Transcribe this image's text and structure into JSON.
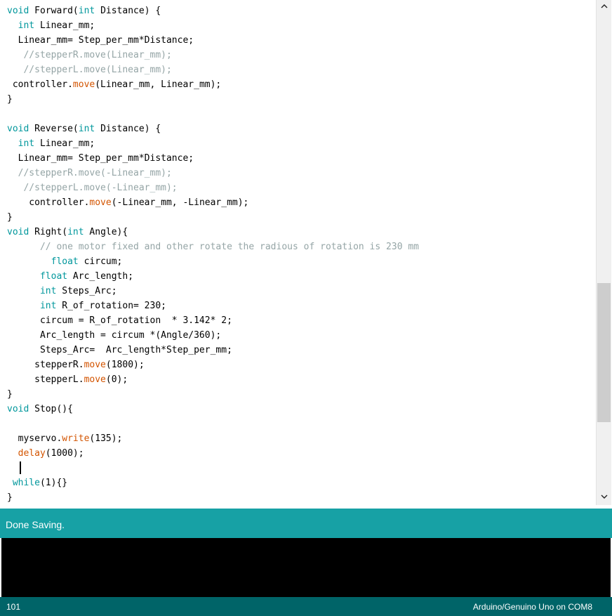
{
  "editor": {
    "lines": [
      [
        {
          "t": "void",
          "k": "kw"
        },
        {
          "t": " Forward(",
          "k": "plain"
        },
        {
          "t": "int",
          "k": "kw"
        },
        {
          "t": " Distance) {",
          "k": "plain"
        }
      ],
      [
        {
          "t": "  ",
          "k": "plain"
        },
        {
          "t": "int",
          "k": "kw"
        },
        {
          "t": " Linear_mm;",
          "k": "plain"
        }
      ],
      [
        {
          "t": "  Linear_mm= Step_per_mm*Distance;",
          "k": "plain"
        }
      ],
      [
        {
          "t": "   //stepperR.move(Linear_mm);",
          "k": "cm"
        }
      ],
      [
        {
          "t": "   //stepperL.move(Linear_mm);",
          "k": "cm"
        }
      ],
      [
        {
          "t": " controller.",
          "k": "plain"
        },
        {
          "t": "move",
          "k": "fn"
        },
        {
          "t": "(Linear_mm, Linear_mm);",
          "k": "plain"
        }
      ],
      [
        {
          "t": "}",
          "k": "plain"
        }
      ],
      [],
      [
        {
          "t": "void",
          "k": "kw"
        },
        {
          "t": " Reverse(",
          "k": "plain"
        },
        {
          "t": "int",
          "k": "kw"
        },
        {
          "t": " Distance) {",
          "k": "plain"
        }
      ],
      [
        {
          "t": "  ",
          "k": "plain"
        },
        {
          "t": "int",
          "k": "kw"
        },
        {
          "t": " Linear_mm;",
          "k": "plain"
        }
      ],
      [
        {
          "t": "  Linear_mm= Step_per_mm*Distance;",
          "k": "plain"
        }
      ],
      [
        {
          "t": "  //stepperR.move(-Linear_mm);",
          "k": "cm"
        }
      ],
      [
        {
          "t": "   //stepperL.move(-Linear_mm);",
          "k": "cm"
        }
      ],
      [
        {
          "t": "    controller.",
          "k": "plain"
        },
        {
          "t": "move",
          "k": "fn"
        },
        {
          "t": "(-Linear_mm, -Linear_mm);",
          "k": "plain"
        }
      ],
      [
        {
          "t": "}",
          "k": "plain"
        }
      ],
      [
        {
          "t": "void",
          "k": "kw"
        },
        {
          "t": " Right(",
          "k": "plain"
        },
        {
          "t": "int",
          "k": "kw"
        },
        {
          "t": " Angle){",
          "k": "plain"
        }
      ],
      [
        {
          "t": "      // one motor fixed and other rotate the radious of rotation is 230 mm",
          "k": "cm"
        }
      ],
      [
        {
          "t": "        ",
          "k": "plain"
        },
        {
          "t": "float",
          "k": "kw"
        },
        {
          "t": " circum;",
          "k": "plain"
        }
      ],
      [
        {
          "t": "      ",
          "k": "plain"
        },
        {
          "t": "float",
          "k": "kw"
        },
        {
          "t": " Arc_length;",
          "k": "plain"
        }
      ],
      [
        {
          "t": "      ",
          "k": "plain"
        },
        {
          "t": "int",
          "k": "kw"
        },
        {
          "t": " Steps_Arc;",
          "k": "plain"
        }
      ],
      [
        {
          "t": "      ",
          "k": "plain"
        },
        {
          "t": "int",
          "k": "kw"
        },
        {
          "t": " R_of_rotation= 230;",
          "k": "plain"
        }
      ],
      [
        {
          "t": "      circum = R_of_rotation  * 3.142* 2;",
          "k": "plain"
        }
      ],
      [
        {
          "t": "      Arc_length = circum *(Angle/360);",
          "k": "plain"
        }
      ],
      [
        {
          "t": "      Steps_Arc=  Arc_length*Step_per_mm;",
          "k": "plain"
        }
      ],
      [
        {
          "t": "     stepperR.",
          "k": "plain"
        },
        {
          "t": "move",
          "k": "fn"
        },
        {
          "t": "(1800);",
          "k": "plain"
        }
      ],
      [
        {
          "t": "     stepperL.",
          "k": "plain"
        },
        {
          "t": "move",
          "k": "fn"
        },
        {
          "t": "(0);",
          "k": "plain"
        }
      ],
      [
        {
          "t": "}",
          "k": "plain"
        }
      ],
      [
        {
          "t": "void",
          "k": "kw"
        },
        {
          "t": " Stop(){",
          "k": "plain"
        }
      ],
      [],
      [
        {
          "t": "  myservo.",
          "k": "plain"
        },
        {
          "t": "write",
          "k": "fn"
        },
        {
          "t": "(135);",
          "k": "plain"
        }
      ],
      [
        {
          "t": "  ",
          "k": "plain"
        },
        {
          "t": "delay",
          "k": "fn"
        },
        {
          "t": "(1000);",
          "k": "plain"
        }
      ],
      [],
      [
        {
          "t": " ",
          "k": "plain"
        },
        {
          "t": "while",
          "k": "kw"
        },
        {
          "t": "(1){}",
          "k": "plain"
        }
      ],
      [
        {
          "t": "}",
          "k": "plain"
        }
      ]
    ],
    "cursor_line": 32
  },
  "status": {
    "message": "Done Saving."
  },
  "footer": {
    "line_number": "101",
    "board_info": "Arduino/Genuino Uno on COM8"
  },
  "colors": {
    "keyword": "#00979c",
    "function": "#d35400",
    "comment": "#95a5a6",
    "status_bar": "#17a1a5",
    "footer_bar": "#006468",
    "console": "#000000"
  },
  "icons": {
    "scroll_up": "chevron-up-icon",
    "scroll_down": "chevron-down-icon"
  }
}
